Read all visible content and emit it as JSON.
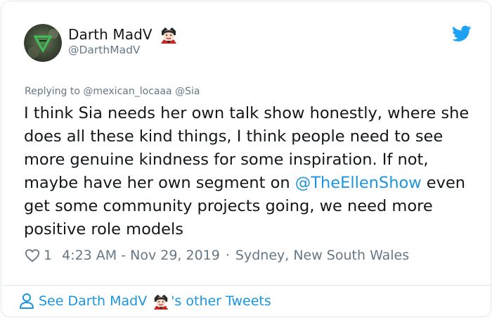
{
  "tweet": {
    "display_name": "Darth MadV",
    "handle": "@DarthMadV",
    "replying_prefix": "Replying to",
    "replying_to": [
      "@mexican_locaaa",
      "@Sia"
    ],
    "text_before_link": "I think Sia needs her own talk show honestly, where she does all these kind things, I think people need to see more genuine kindness for some inspiration. If not, maybe have her own segment on ",
    "link_text": "@TheEllenShow",
    "text_after_link": " even get some community projects going, we need more positive role models",
    "like_count": "1",
    "timestamp": "4:23 AM - Nov 29, 2019",
    "separator": "·",
    "location": "Sydney, New South Wales"
  },
  "footer": {
    "see_prefix": "See Darth MadV",
    "see_suffix": "'s other Tweets"
  },
  "icons": {
    "avatar": "avatar-image",
    "name_emoji": "vampire-emoji",
    "brand": "twitter-bird-icon",
    "like": "heart-icon",
    "profile": "person-icon"
  },
  "colors": {
    "link": "#1b95e0",
    "muted": "#657786",
    "text": "#14171a",
    "border": "#e1e8ed"
  }
}
